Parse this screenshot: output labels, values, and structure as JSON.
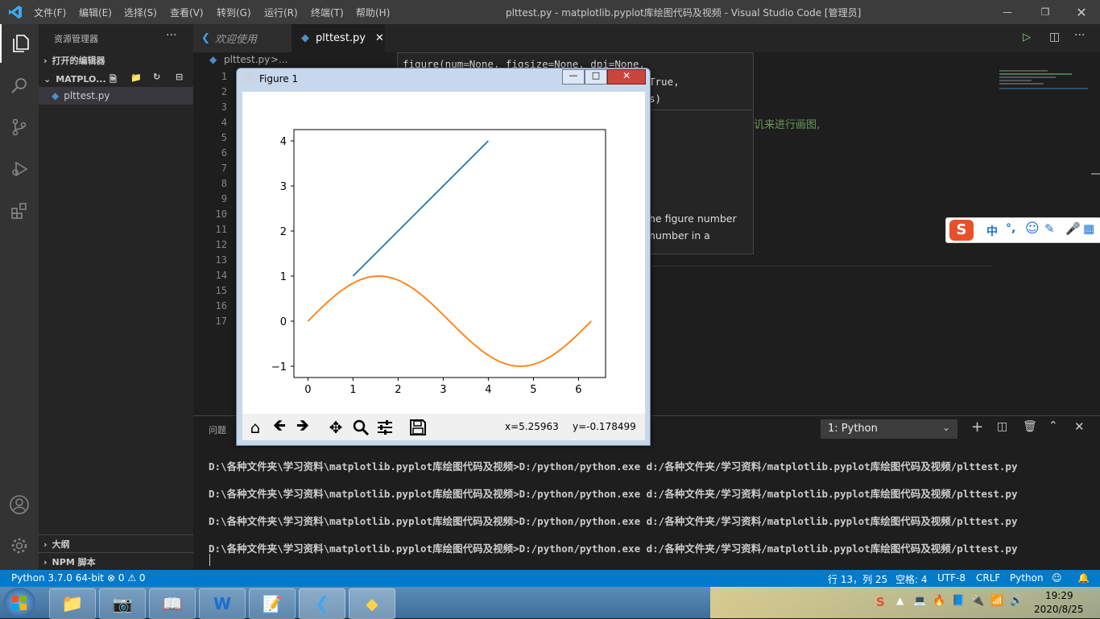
{
  "titlebar": {
    "menus": [
      "文件(F)",
      "编辑(E)",
      "选择(S)",
      "查看(V)",
      "转到(G)",
      "运行(R)",
      "终端(T)",
      "帮助(H)"
    ],
    "window_title": "plttest.py - matplotlib.pyplot库绘图代码及视频 - Visual Studio Code [管理员]"
  },
  "sidebar": {
    "title": "资源管理器",
    "open_editors": "打开的编辑器",
    "folder": "MATPLO...",
    "file": "plttest.py",
    "outline": "大纲",
    "npm": "NPM 脚本"
  },
  "tabs": [
    {
      "label": "欢迎使用"
    },
    {
      "label": "plttest.py",
      "active": true
    }
  ],
  "breadcrumb": {
    "file": "plttest.py",
    "sep": ">",
    "more": "..."
  },
  "editor": {
    "line_numbers": [
      "1",
      "2",
      "3",
      "4",
      "5",
      "6",
      "7",
      "8",
      "9",
      "10",
      "11",
      "12",
      "13",
      "14",
      "15",
      "16",
      "17"
    ]
  },
  "hover": {
    "sig1": "figure(num=None, figsize=None, dpi=None,",
    "sig2": "True,",
    "sig3": "s)",
    "comment": "讥来进行画图,",
    "doc1": "he figure number",
    "doc2": "number in a"
  },
  "figure_window": {
    "title": "Figure 1",
    "coords_x": "x=5.25963",
    "coords_y": "y=-0.178499"
  },
  "chart_data": {
    "type": "line",
    "xlim": [
      -0.31,
      6.6
    ],
    "ylim": [
      -1.25,
      4.25
    ],
    "xticks": [
      "0",
      "1",
      "2",
      "3",
      "4",
      "5",
      "6"
    ],
    "yticks": [
      "−1",
      "0",
      "1",
      "2",
      "3",
      "4"
    ],
    "series": [
      {
        "color": "#1f77b4",
        "x": [
          1,
          4
        ],
        "y": [
          1,
          4
        ]
      },
      {
        "color": "#ff7f0e",
        "function": "sin",
        "x": [
          0,
          6.283
        ],
        "y": [
          0,
          0
        ]
      }
    ]
  },
  "panel": {
    "problems_tab": "问题",
    "terminal_select": "1: Python",
    "lines": [
      "D:\\各种文件夹\\学习资料\\matplotlib.pyplot库绘图代码及视频>D:/python/python.exe d:/各种文件夹/学习资料/matplotlib.pyplot库绘图代码及视频/plttest.py",
      "D:\\各种文件夹\\学习资料\\matplotlib.pyplot库绘图代码及视频>D:/python/python.exe d:/各种文件夹/学习资料/matplotlib.pyplot库绘图代码及视频/plttest.py",
      "D:\\各种文件夹\\学习资料\\matplotlib.pyplot库绘图代码及视频>D:/python/python.exe d:/各种文件夹/学习资料/matplotlib.pyplot库绘图代码及视频/plttest.py",
      "D:\\各种文件夹\\学习资料\\matplotlib.pyplot库绘图代码及视频>D:/python/python.exe d:/各种文件夹/学习资料/matplotlib.pyplot库绘图代码及视频/plttest.py"
    ]
  },
  "status": {
    "python": "Python 3.7.0 64-bit",
    "errors": "⊗ 0 ⚠ 0",
    "position": "行 13，列 25",
    "spaces": "空格: 4",
    "encoding": "UTF-8",
    "eol": "CRLF",
    "language": "Python"
  },
  "ime": {
    "chars": [
      "中",
      "°,"
    ]
  },
  "taskbar": {
    "time": "19:29",
    "date": "2020/8/25"
  }
}
